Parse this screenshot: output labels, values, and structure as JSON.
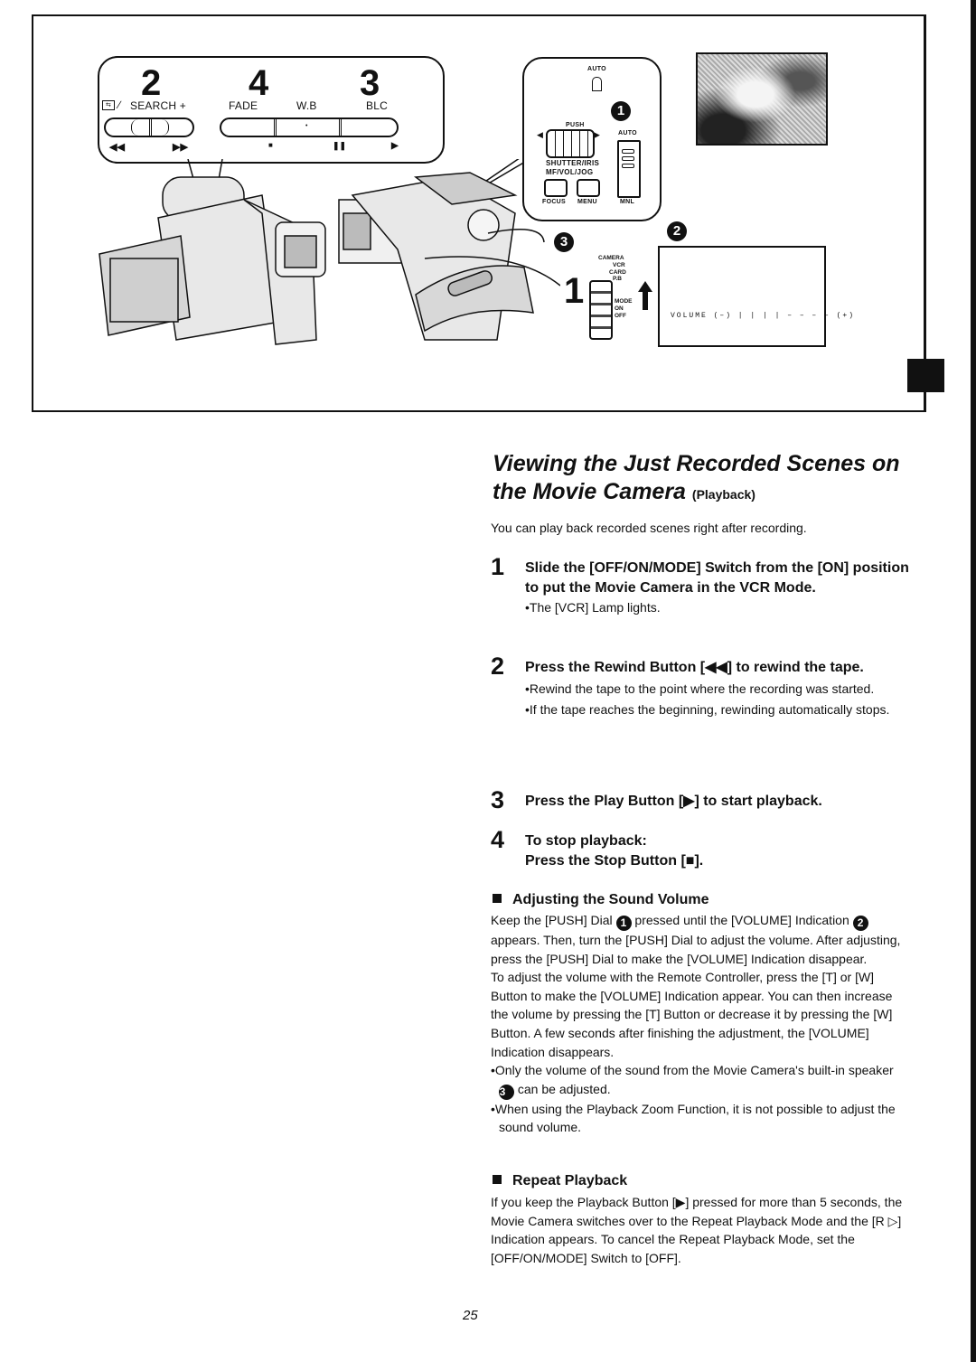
{
  "figure": {
    "control_panel": {
      "step_numbers": [
        "2",
        "4",
        "3"
      ],
      "labels": {
        "search": "SEARCH +",
        "fade": "FADE",
        "wb": "W.B",
        "blc": "BLC"
      },
      "symbols": [
        "◀◀",
        "▶▶",
        "■",
        "❚❚",
        "▶"
      ]
    },
    "dial_panel": {
      "auto_top": "AUTO",
      "push": "PUSH",
      "auto_side": "AUTO",
      "shutter_iris": "SHUTTER/IRIS",
      "mf_vol_jog": "MF/VOL/JOG",
      "focus": "FOCUS",
      "menu": "MENU",
      "mnl": "MNL",
      "callout_1": "1"
    },
    "callout_2": "2",
    "callout_3": "3",
    "step_1": "1",
    "mode_switch": {
      "camera": "CAMERA",
      "vcr": "VCR",
      "card": "CARD",
      "pb": "P.B",
      "mode": "MODE",
      "on": "ON",
      "off": "OFF"
    },
    "volume_indicator": "VOLUME  (–) | | | | – – – – (+)"
  },
  "title": {
    "main_line1": "Viewing the Just Recorded Scenes on",
    "main_line2": "the Movie Camera",
    "suffix": "(Playback)"
  },
  "intro": "You can play back recorded scenes right after recording.",
  "steps": [
    {
      "num": "1",
      "text": "Slide the [OFF/ON/MODE] Switch from the [ON] position to put the Movie Camera in the VCR Mode.",
      "bullets": [
        "•The [VCR] Lamp lights."
      ]
    },
    {
      "num": "2",
      "text": "Press the Rewind Button [◀◀] to rewind the tape.",
      "bullets": [
        "•Rewind the tape to the point where the recording was started.",
        "•If the tape reaches the beginning, rewinding automatically stops."
      ]
    },
    {
      "num": "3",
      "text": "Press the Play Button [▶] to start playback.",
      "bullets": []
    },
    {
      "num": "4",
      "text_line1": "To stop playback:",
      "text_line2": "Press the Stop Button [■].",
      "bullets": []
    }
  ],
  "sound_volume": {
    "heading": "Adjusting the Sound Volume",
    "p1_a": "Keep the [PUSH] Dial",
    "p1_circ1": "1",
    "p1_b": "pressed until the [VOLUME] Indication",
    "p1_circ2": "2",
    "p1_c": "appears. Then, turn the [PUSH] Dial to adjust the volume. After adjusting, press the [PUSH] Dial to make the [VOLUME] Indication disappear.",
    "p2": "To adjust the volume with the Remote Controller, press the [T] or [W] Button to make the [VOLUME] Indication appear. You can then increase the volume by pressing the [T] Button or decrease it by pressing the [W] Button. A few seconds after finishing the adjustment, the [VOLUME] Indication disappears.",
    "b1_a": "•Only the volume of the sound from the Movie Camera's built-in speaker",
    "b1_circ": "3",
    "b1_b": "can be adjusted.",
    "b2": "•When using the Playback Zoom Function, it is not possible to adjust the sound volume."
  },
  "repeat_playback": {
    "heading": "Repeat Playback",
    "text": "If you keep the Playback Button [▶] pressed for more than 5 seconds, the Movie Camera switches over to the Repeat Playback Mode and the [R ▷] Indication appears. To cancel the Repeat Playback Mode, set the [OFF/ON/MODE] Switch to [OFF]."
  },
  "page_number": "25"
}
